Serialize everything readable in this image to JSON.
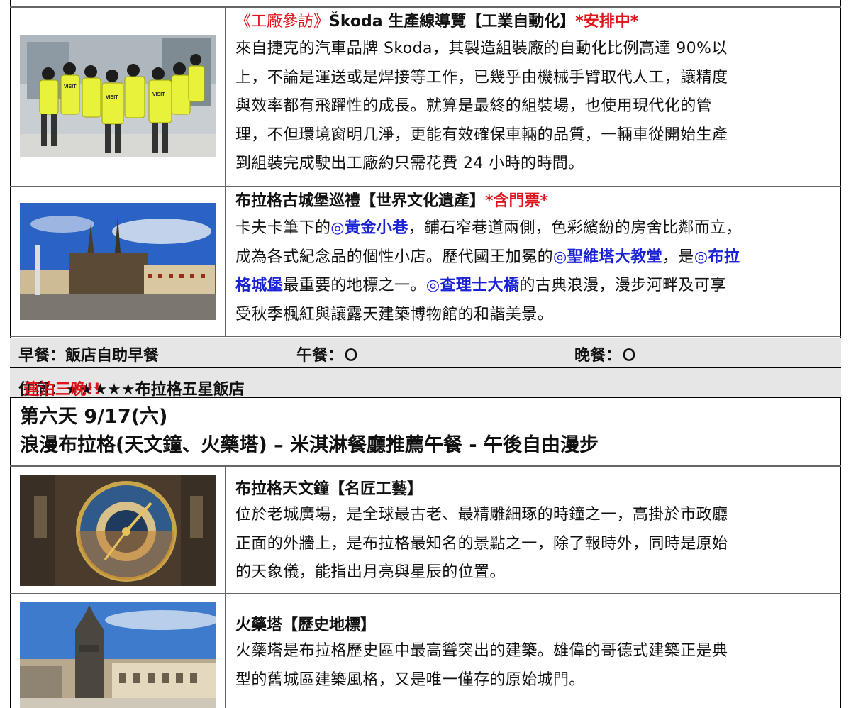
{
  "items": [
    {
      "title_prefix": "《工廠參訪》",
      "title_main": "Škoda 生產線導覽【工業自動化】",
      "title_note": "*安排中*",
      "lines": [
        "來自捷克的汽車品牌 Skoda，其製造組裝廠的自動化比例高達 90%以",
        "上，不論是運送或是焊接等工作，已幾乎由機械手臂取代人工，讓精度",
        "與效率都有飛躍性的成長。就算是最終的組裝場，也使用現代化的管",
        "理，不但環境窗明几淨，更能有效確保車輛的品質，一輛車從開始生產",
        "到組裝完成駛出工廠約只需花費 24 小時的時間。"
      ],
      "photo_text": "VISIT"
    },
    {
      "title_main": "布拉格古城堡巡禮【世界文化遺產】",
      "title_note": "*含門票*",
      "line1_a": "卡夫卡筆下的",
      "line1_link": "◎黃金小巷",
      "line1_b": "，鋪石窄巷道兩側，色彩繽紛的房舍比鄰而立，",
      "line2_a": "成為各式紀念品的個性小店。歷代國王加冕的",
      "line2_link1": "◎聖維塔大教堂",
      "line2_b": "，是",
      "line2_link2": "◎布拉",
      "line3_link": "格城堡",
      "line3_a": "最重要的地標之一。",
      "line3_link2": "◎查理士大橋",
      "line3_b": "的古典浪漫，漫步河畔及可享",
      "line4": "受秋季楓紅與讓露天建築博物館的和諧美景。"
    },
    {
      "title_main": "布拉格天文鐘【名匠工藝】",
      "lines": [
        "位於老城廣場，是全球最古老、最精雕細琢的時鐘之一，高掛於市政廳",
        "正面的外牆上，是布拉格最知名的景點之一，除了報時外，同時是原始",
        "的天象儀，能指出月亮與星辰的位置。"
      ]
    },
    {
      "title_main": "火藥塔【歷史地標】",
      "lines": [
        "火藥塔是布拉格歷史區中最高聳突出的建築。雄偉的哥德式建築正是典",
        "型的舊城區建築風格，又是唯一僅存的原始城門。"
      ]
    }
  ],
  "meals": {
    "breakfast": "早餐：飯店自助早餐",
    "lunch": "午餐：Ｏ",
    "dinner": "晚餐：Ｏ"
  },
  "lodging": {
    "label": "住宿：★★★★★布拉格五星飯店",
    "note": "連泊三晚!!"
  },
  "day6": {
    "line1": "第六天  9/17(六)",
    "line2": "浪漫布拉格(天文鐘、火藥塔) – 米淇淋餐廳推薦午餐  -  午後自由漫步"
  },
  "colors": {
    "accent_red": "#e0131b",
    "link_blue": "#1a22d6",
    "meal_bg": "#e6e6e6"
  }
}
